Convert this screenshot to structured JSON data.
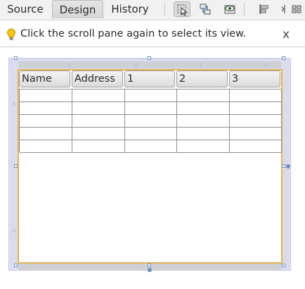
{
  "tabs": [
    {
      "label": "Source",
      "active": false
    },
    {
      "label": "Design",
      "active": true
    },
    {
      "label": "History",
      "active": false
    }
  ],
  "toolbar_icons": [
    "selection-mode-icon",
    "connection-mode-icon",
    "preview-design-icon",
    "align-left-icon",
    "align-more-icon"
  ],
  "hint": {
    "text": "Click the scroll pane again to select its view.",
    "close": "x"
  },
  "table": {
    "columns": [
      "Name",
      "Address",
      "1",
      "2",
      "3"
    ],
    "row_count": 5
  },
  "colors": {
    "selection_border": "#e3b35b",
    "scroll_pane": "#dcdcf0",
    "handle": "#6f8fb7"
  }
}
